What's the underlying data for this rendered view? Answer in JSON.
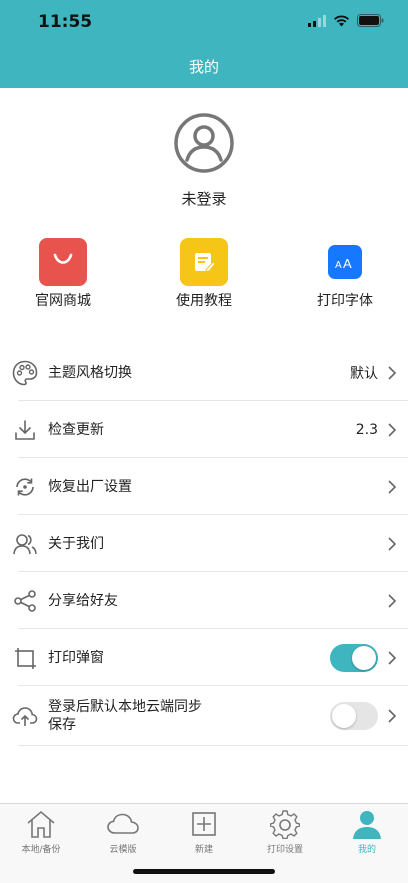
{
  "status_bar": {
    "time": "11:55"
  },
  "header": {
    "title": "我的"
  },
  "profile": {
    "login_label": "未登录"
  },
  "shortcuts": [
    {
      "label": "官网商城",
      "icon": "shopping-bag-icon",
      "color": "#e8534e"
    },
    {
      "label": "使用教程",
      "icon": "notepad-icon",
      "color": "#f5c518"
    },
    {
      "label": "打印字体",
      "icon": "font-icon",
      "color": "#1677ff"
    }
  ],
  "settings": [
    {
      "label": "主题风格切换",
      "value": "默认",
      "icon": "palette-icon"
    },
    {
      "label": "检查更新",
      "value": "2.3",
      "icon": "download-icon"
    },
    {
      "label": "恢复出厂设置",
      "value": "",
      "icon": "reset-icon"
    },
    {
      "label": "关于我们",
      "value": "",
      "icon": "users-icon"
    },
    {
      "label": "分享给好友",
      "value": "",
      "icon": "share-icon"
    },
    {
      "label": "打印弹窗",
      "toggle": true,
      "icon": "frame-icon"
    },
    {
      "label_line1": "登录后默认本地云端同步",
      "label_line2": "保存",
      "toggle": false,
      "icon": "cloud-upload-icon"
    }
  ],
  "tabbar": [
    {
      "label": "本地/备份",
      "icon": "home-icon",
      "active": false
    },
    {
      "label": "云模版",
      "icon": "cloud-icon",
      "active": false
    },
    {
      "label": "新建",
      "icon": "plus-square-icon",
      "active": false
    },
    {
      "label": "打印设置",
      "icon": "gear-icon",
      "active": false
    },
    {
      "label": "我的",
      "icon": "person-icon",
      "active": true
    }
  ],
  "colors": {
    "accent": "#3fb5bf",
    "text": "#222222",
    "divider": "#e6e6e6"
  }
}
